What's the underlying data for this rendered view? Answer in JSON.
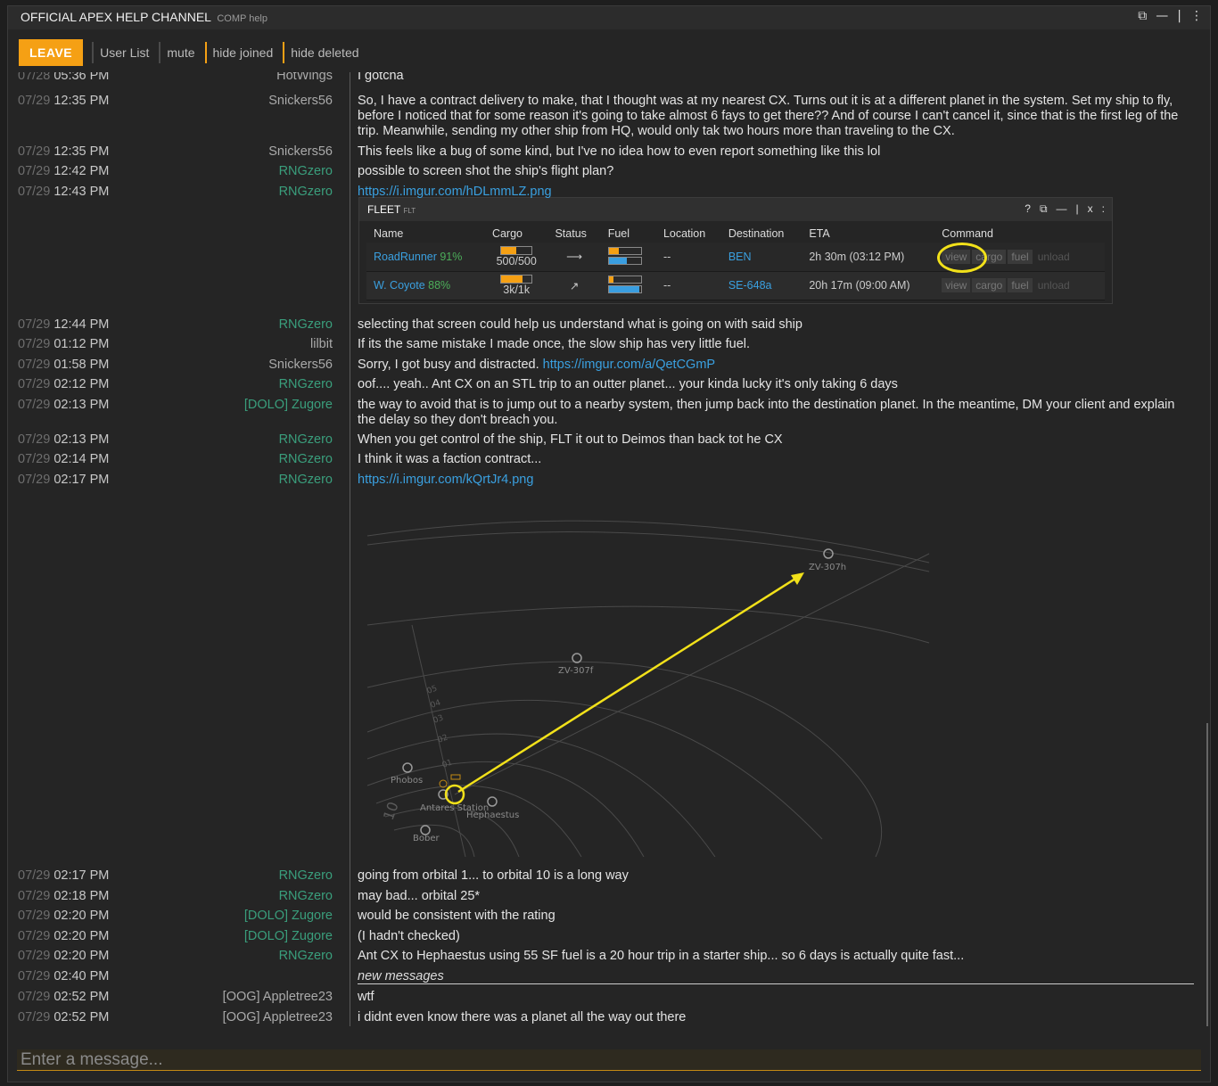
{
  "window": {
    "title": "OFFICIAL APEX HELP CHANNEL",
    "subtitle": "COMP help",
    "controls": [
      "⧉",
      "—",
      "|",
      "⋮"
    ]
  },
  "toolbar": {
    "leave": "LEAVE",
    "user_list": "User List",
    "mute": "mute",
    "hide_joined": "hide joined",
    "hide_deleted": "hide deleted"
  },
  "messages": [
    {
      "date": "07/28",
      "time": "05:36 PM",
      "user": "HotWings",
      "green": false,
      "text": "I gotcha"
    },
    {
      "date": "07/29",
      "time": "12:35 PM",
      "user": "Snickers56",
      "green": false,
      "text": "So, I have a contract delivery to make, that I thought was at my nearest CX. Turns out it is at a different planet in the system. Set my ship to fly, before I noticed that for some reason it's going to take almost 6 fays to get there?? And of course I can't cancel it, since that is the first leg of the trip. Meanwhile, sending my other ship from HQ, would only tak two hours more than traveling to the CX."
    },
    {
      "date": "07/29",
      "time": "12:35 PM",
      "user": "Snickers56",
      "green": false,
      "text": "This feels like a bug of some kind, but I've no idea how to even report something like this lol"
    },
    {
      "date": "07/29",
      "time": "12:42 PM",
      "user": "RNGzero",
      "green": true,
      "text": "possible to screen shot the ship's flight plan?"
    },
    {
      "date": "07/29",
      "time": "12:43 PM",
      "user": "RNGzero",
      "green": true,
      "link": "https://i.imgur.com/hDLmmLZ.png"
    },
    {
      "date": "07/29",
      "time": "12:44 PM",
      "user": "RNGzero",
      "green": true,
      "text": "selecting that screen could help us understand what is going on with said ship"
    },
    {
      "date": "07/29",
      "time": "01:12 PM",
      "user": "lilbit",
      "green": false,
      "text": "If its the same mistake I made once, the slow ship has very little fuel."
    },
    {
      "date": "07/29",
      "time": "01:58 PM",
      "user": "Snickers56",
      "green": false,
      "text": "Sorry, I got busy and distracted. ",
      "link": "https://imgur.com/a/QetCGmP"
    },
    {
      "date": "07/29",
      "time": "02:12 PM",
      "user": "RNGzero",
      "green": true,
      "text": "oof.... yeah.. Ant CX on an STL trip to an outter planet... your kinda lucky it's only taking 6 days"
    },
    {
      "date": "07/29",
      "time": "02:13 PM",
      "user": "[DOLO] Zugore",
      "green": true,
      "text": "the way to avoid that is to jump out to a nearby system, then jump back into the destination planet. In the meantime, DM your client and explain the delay so they don't breach you."
    },
    {
      "date": "07/29",
      "time": "02:13 PM",
      "user": "RNGzero",
      "green": true,
      "text": "When you get control of the ship, FLT it out to Deimos than back tot he CX"
    },
    {
      "date": "07/29",
      "time": "02:14 PM",
      "user": "RNGzero",
      "green": true,
      "text": "I think it was a faction contract..."
    },
    {
      "date": "07/29",
      "time": "02:17 PM",
      "user": "RNGzero",
      "green": true,
      "link": "https://i.imgur.com/kQrtJr4.png"
    },
    {
      "date": "07/29",
      "time": "02:17 PM",
      "user": "RNGzero",
      "green": true,
      "text": "going from orbital 1... to orbital 10 is a long way"
    },
    {
      "date": "07/29",
      "time": "02:18 PM",
      "user": "RNGzero",
      "green": true,
      "text": "may bad... orbital 25*"
    },
    {
      "date": "07/29",
      "time": "02:20 PM",
      "user": "[DOLO] Zugore",
      "green": true,
      "text": "would be consistent with the rating"
    },
    {
      "date": "07/29",
      "time": "02:20 PM",
      "user": "[DOLO] Zugore",
      "green": true,
      "text": "(I hadn't checked)"
    },
    {
      "date": "07/29",
      "time": "02:20 PM",
      "user": "RNGzero",
      "green": true,
      "text": "Ant CX to Hephaestus using 55 SF fuel is a 20 hour trip in a starter ship... so 6 days is actually quite fast..."
    },
    {
      "date": "07/29",
      "time": "02:40 PM",
      "user": "",
      "green": false,
      "new_messages": "new messages"
    },
    {
      "date": "07/29",
      "time": "02:52 PM",
      "user": "[OOG] Appletree23",
      "green": false,
      "text": "wtf"
    },
    {
      "date": "07/29",
      "time": "02:52 PM",
      "user": "[OOG] Appletree23",
      "green": false,
      "text": "i didnt even know there was a planet all the way out there"
    }
  ],
  "fleet": {
    "title": "FLEET",
    "sub": "FLT",
    "controls": [
      "?",
      "⧉",
      "—",
      "|",
      "x",
      ":"
    ],
    "headers": [
      "Name",
      "Cargo",
      "Status",
      "Fuel",
      "Location",
      "Destination",
      "ETA",
      "Command"
    ],
    "rows": [
      {
        "name": "RoadRunner",
        "cond": "91%",
        "cargo": "500/500",
        "cargo_fill": 0.5,
        "status": "⟶",
        "fuel_ff": 0.3,
        "fuel_sf": 0.55,
        "location": "--",
        "dest": "BEN",
        "eta": "2h 30m (03:12 PM)"
      },
      {
        "name": "W. Coyote",
        "cond": "88%",
        "cargo": "3k/1k",
        "cargo_fill": 0.7,
        "status": "↗",
        "fuel_ff": 0.15,
        "fuel_sf": 0.95,
        "location": "--",
        "dest": "SE-648a",
        "eta": "20h 17m (09:00 AM)"
      }
    ],
    "commands": [
      "view",
      "cargo",
      "fuel",
      "unload"
    ]
  },
  "map": {
    "labels": {
      "zv307h": "ZV-307h",
      "zv307f": "ZV-307f",
      "phobos": "Phobos",
      "antares": "Antares Station",
      "hephaestus": "Hephaestus",
      "bober": "Bober",
      "deimos": "Deimos"
    },
    "orbit_labels": [
      "01",
      "02",
      "03",
      "04",
      "05",
      "10"
    ],
    "highlight_color": "#f2e11a"
  },
  "input": {
    "placeholder": "Enter a message..."
  }
}
